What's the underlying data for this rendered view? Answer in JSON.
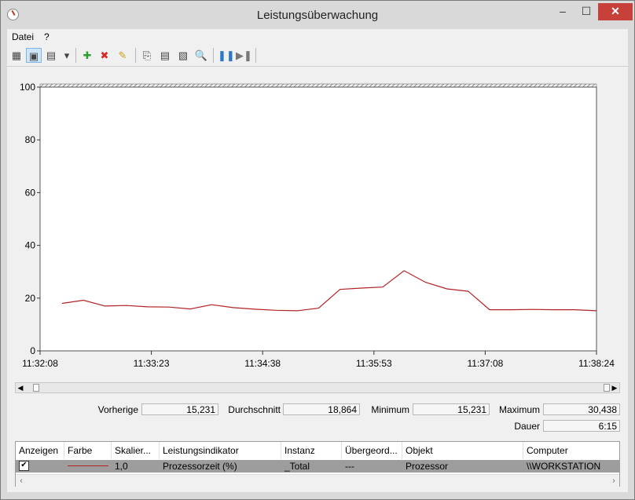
{
  "window": {
    "title": "Leistungsüberwachung",
    "min": "–",
    "max": "☐",
    "close": "✕"
  },
  "menu": [
    "Datei",
    "?"
  ],
  "toolbar": [
    {
      "icon": "view-graph-icon",
      "glyph": "▦"
    },
    {
      "icon": "view-histogram-icon",
      "glyph": "▣",
      "active": true
    },
    {
      "icon": "change-graph-type-icon",
      "glyph": "▤"
    },
    {
      "icon": "dropdown-arrow-icon",
      "glyph": "▾"
    },
    {
      "icon": "add-counter-icon",
      "glyph": "✚",
      "color": "#2e9e2e"
    },
    {
      "icon": "delete-counter-icon",
      "glyph": "✖",
      "color": "#d42a2a"
    },
    {
      "icon": "highlight-icon",
      "glyph": "✎",
      "color": "#c9a21d"
    },
    {
      "icon": "copy-properties-icon",
      "glyph": "⎘"
    },
    {
      "icon": "paste-counter-list-icon",
      "glyph": "▤"
    },
    {
      "icon": "properties-icon",
      "glyph": "▧"
    },
    {
      "icon": "zoom-icon",
      "glyph": "🔍"
    },
    {
      "icon": "freeze-display-icon",
      "glyph": "❚❚",
      "color": "#2b79c6"
    },
    {
      "icon": "update-data-icon",
      "glyph": "▶❚",
      "color": "#777777"
    }
  ],
  "chart_data": {
    "type": "line",
    "ylim": [
      0,
      100
    ],
    "yticks": [
      0,
      20,
      40,
      60,
      80,
      100
    ],
    "xtick_labels": [
      "11:32:08",
      "11:33:23",
      "11:34:38",
      "11:35:53",
      "11:37:08",
      "11:38:24"
    ],
    "grid": false,
    "series": [
      {
        "color": "#b22222",
        "values": [
          18.0,
          19.2,
          17.0,
          17.2,
          16.7,
          16.6,
          15.9,
          17.5,
          16.4,
          15.8,
          15.4,
          15.2,
          16.2,
          23.3,
          23.8,
          24.2,
          30.4,
          26.0,
          23.5,
          22.6,
          15.6,
          15.6,
          15.7,
          15.6,
          15.6,
          15.2
        ]
      }
    ]
  },
  "stats": {
    "vorherige_label": "Vorherige",
    "vorherige": "15,231",
    "durchschnitt_label": "Durchschnitt",
    "durchschnitt": "18,864",
    "minimum_label": "Minimum",
    "minimum": "15,231",
    "maximum_label": "Maximum",
    "maximum": "30,438",
    "dauer_label": "Dauer",
    "dauer": "6:15"
  },
  "table": {
    "headers": [
      "Anzeigen",
      "Farbe",
      "Skalier...",
      "Leistungsindikator",
      "Instanz",
      "Übergeord...",
      "Objekt",
      "Computer"
    ],
    "rows": [
      {
        "checked": "✔",
        "color": "#b22222",
        "scale": "1,0",
        "counter": "Prozessorzeit (%)",
        "instance": "_Total",
        "parent": "---",
        "object": "Prozessor",
        "computer": "\\\\WORKSTATION"
      }
    ]
  }
}
